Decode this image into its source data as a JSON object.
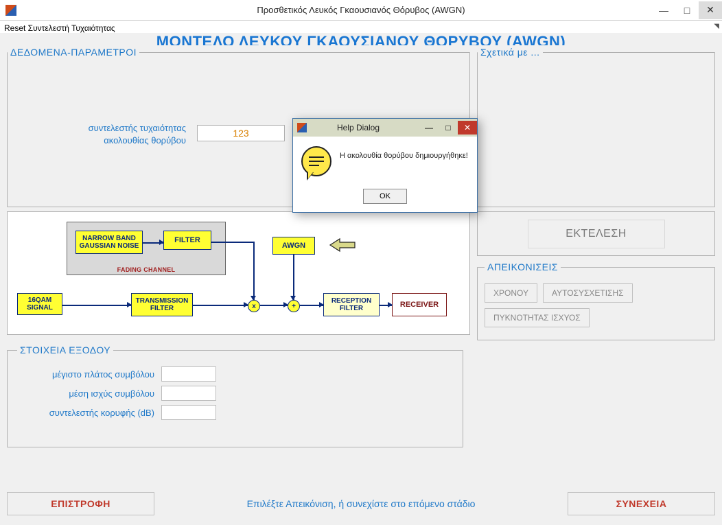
{
  "window": {
    "title": "Προσθετικός Λευκός Γκαουσιανός Θόρυβος (AWGN)",
    "min_icon": "—",
    "max_icon": "□",
    "close_icon": "✕"
  },
  "toolbar": {
    "reset": "Reset Συντελεστή Τυχαιότητας"
  },
  "cut_title": "ΜΟΝΤΕΛΟ ΛΕΥΚΟΥ ΓΚΑΟΥΣΙΑΝΟΥ ΘΟΡΥΒΟΥ (AWGN)",
  "groups": {
    "data_params": "ΔΕΔΟΜΕΝΑ-ΠΑΡΑΜΕΤΡΟΙ",
    "about": "Σχετικά με ...",
    "depictions": "ΑΠΕΙΚΟΝΙΣΕΙΣ",
    "output": "ΣΤΟΙΧΕΙΑ ΕΞΟΔΟΥ"
  },
  "params": {
    "seed_label": "συντελεστής τυχαιότητας ακολουθίας θορύβου",
    "seed_value": "123"
  },
  "diagram": {
    "nbn": "NARROW BAND GAUSSIAN NOISE",
    "filter": "FILTER",
    "fading": "FADING CHANNEL",
    "awgn": "AWGN",
    "qam": "16QAM SIGNAL",
    "txf": "TRANSMISSION FILTER",
    "rxf": "RECEPTION FILTER",
    "rcv": "RECEIVER",
    "mul": "x",
    "add": "+"
  },
  "right_panel": {
    "execute": "ΕΚΤΕΛΕΣΗ",
    "time": "ΧΡΟΝΟΥ",
    "autocorr": "ΑΥΤΟΣΥΣΧΕΤΙΣΗΣ",
    "psd": "ΠΥΚΝΟΤΗΤΑΣ ΙΣΧΥΟΣ"
  },
  "output": {
    "max_amp": "μέγιστο πλάτος συμβόλου",
    "mean_pow": "μέση ισχύς συμβόλου",
    "crest": "συντελεστής κορυφής (dB)",
    "max_amp_val": "",
    "mean_pow_val": "",
    "crest_val": ""
  },
  "footer": {
    "back": "ΕΠΙΣΤΡΟΦΗ",
    "next": "ΣΥΝΕΧΕΙΑ",
    "hint": "Επιλέξτε Απεικόνιση, ή συνεχίστε στο επόμενο στάδιο"
  },
  "dialog": {
    "title": "Help Dialog",
    "message": "Η ακολουθία θορύβου δημιουργήθηκε!",
    "ok": "OK",
    "min_icon": "—",
    "max_icon": "□",
    "close_icon": "✕"
  }
}
